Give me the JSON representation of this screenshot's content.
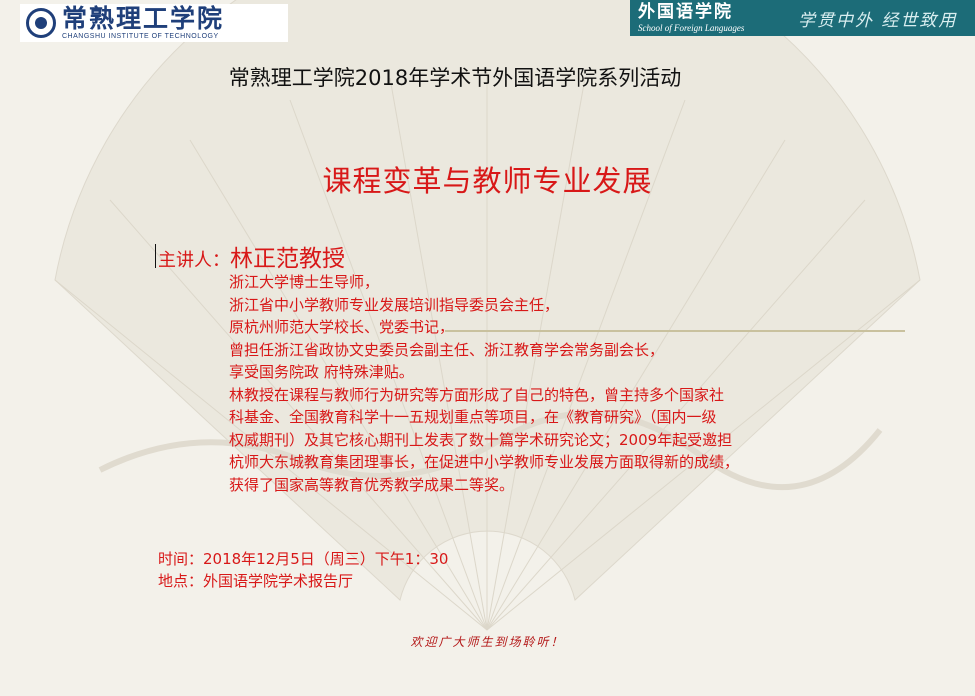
{
  "header": {
    "institute_name_cn": "常熟理工学院",
    "institute_name_en": "CHANGSHU INSTITUTE OF TECHNOLOGY",
    "school_name_cn": "外国语学院",
    "school_name_en": "School of Foreign Languages",
    "school_motto": "学贯中外  经世致用"
  },
  "series_title": "常熟理工学院2018年学术节外国语学院系列活动",
  "talk_title": "课程变革与教师专业发展",
  "speaker": {
    "label": "主讲人：",
    "name": "林正范教授"
  },
  "bio_lines": [
    "浙江大学博士生导师，",
    "浙江省中小学教师专业发展培训指导委员会主任，",
    "原杭州师范大学校长、党委书记，",
    "曾担任浙江省政协文史委员会副主任、浙江教育学会常务副会长，",
    "享受国务院政 府特殊津贴。",
    "林教授在课程与教师行为研究等方面形成了自己的特色，曾主持多个国家社",
    "科基金、全国教育科学十一五规划重点等项目，在《教育研究》（国内一级",
    "权威期刊）及其它核心期刊上发表了数十篇学术研究论文；2009年起受邀担",
    "杭师大东城教育集团理事长，在促进中小学教师专业发展方面取得新的成绩，",
    "获得了国家高等教育优秀教学成果二等奖。"
  ],
  "event": {
    "time": "时间：2018年12月5日（周三）下午1：30",
    "place": "地点：外国语学院学术报告厅"
  },
  "welcome": "欢迎广大师生到场聆听！",
  "colors": {
    "accent_red": "#d81818",
    "logo_blue": "#1f3f7a",
    "banner_teal": "#1c6c78",
    "background": "#f3f1ea"
  }
}
